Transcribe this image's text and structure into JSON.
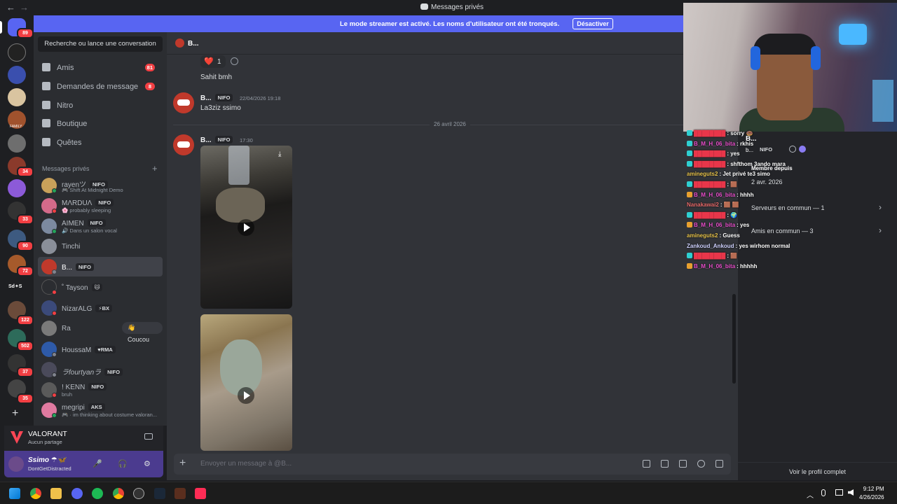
{
  "window": {
    "title": "Messages privés",
    "back": "←",
    "forward": "→"
  },
  "banner": {
    "text": "Le mode streamer est activé. Les noms d'utilisateur ont été tronqués.",
    "button": "Désactiver"
  },
  "rail": {
    "badges": [
      "89",
      "34",
      "33",
      "90",
      "72",
      "122",
      "502",
      "37",
      "35"
    ],
    "text_server": "Sd✦S",
    "family_label": "FAMILY",
    "add": "+"
  },
  "sidebar": {
    "search": "Recherche ou lance une conversation",
    "nav": [
      {
        "label": "Amis",
        "badge": "81"
      },
      {
        "label": "Demandes de message",
        "badge": "8"
      },
      {
        "label": "Nitro",
        "badge": ""
      },
      {
        "label": "Boutique",
        "badge": ""
      },
      {
        "label": "Quêtes",
        "badge": ""
      }
    ],
    "dm_header": "Messages privés",
    "dm_plus": "+",
    "dms": [
      {
        "name": "rayenツ",
        "tag": "NIFO",
        "sub": "🎮 Shift At Midnight Demo"
      },
      {
        "name": "MΛRDUΛ",
        "tag": "NIFO",
        "sub": "🌸 probably sleeping"
      },
      {
        "name": "AIMEN",
        "tag": "NIFO",
        "sub": "🔊 Dans un salon vocal"
      },
      {
        "name": "Tinchi",
        "tag": "",
        "sub": ""
      },
      {
        "name": "B...",
        "tag": "NIFO",
        "sub": ""
      },
      {
        "name": "˚ Tayson",
        "tag": "🐱",
        "sub": ""
      },
      {
        "name": "NizarALG",
        "tag": "⚡BX",
        "sub": ""
      },
      {
        "name": "Ra",
        "tag": "",
        "sub": "",
        "action": "👋 Coucou"
      },
      {
        "name": "HoussaM",
        "tag": "♥RMA",
        "sub": ""
      },
      {
        "name": "ラfourtyanラ",
        "tag": "NIFO",
        "sub": ""
      },
      {
        "name": "! KENN",
        "tag": "NIFO",
        "sub": "bruh"
      },
      {
        "name": "megripi",
        "tag": "AKS",
        "sub": "🎮 · im thinking about costume valoran..."
      }
    ]
  },
  "voice": {
    "game": "VALORANT",
    "status": "Aucun partage"
  },
  "user": {
    "name": "Ssimo ☂🦋",
    "status": "DontGetDistracted",
    "mic": "🎤",
    "headset": "🎧",
    "settings": "⚙"
  },
  "chat": {
    "header_name": "B...",
    "reaction": {
      "emoji": "❤️",
      "count": "1"
    },
    "messages": [
      {
        "text": "Sahit bmh"
      },
      {
        "author": "B...",
        "tag": "NIFO",
        "time": "22/04/2026 19:18",
        "text": "La3ziz ssimo"
      },
      {
        "author": "B...",
        "tag": "NIFO",
        "time": "17:30"
      }
    ],
    "divider": "26 avril 2026",
    "composer_plus": "+",
    "composer_placeholder": "Envoyer un message à @B...",
    "download": "⤓"
  },
  "profile": {
    "name": "B...",
    "sub": "b...",
    "tag": "NIFO",
    "member_label": "Membre depuis",
    "member_date": "2 avr. 2026",
    "rows": [
      {
        "label": "Serveurs en commun — 1",
        "chevron": "›"
      },
      {
        "label": "Amis en commun — 3",
        "chevron": "›"
      }
    ],
    "full": "Voir le profil complet"
  },
  "stream_chat": [
    {
      "user": "████████",
      "msg": ": sorry 🍩",
      "color": "#e8364a",
      "badge": "#2ecfd1"
    },
    {
      "user": "B_M_H_06_bita",
      "msg": ": rkhis",
      "color": "#e84ecb",
      "badge": "#2ecfd1"
    },
    {
      "user": "████████",
      "msg": ": yes",
      "color": "#e8364a",
      "badge": "#2ecfd1"
    },
    {
      "user": "████████",
      "msg": ": shfthom 3ando mara",
      "color": "#e8364a",
      "badge": "#2ecfd1"
    },
    {
      "user": "amineguts2",
      "msg": ": Jet privé te3 simo",
      "color": "#e6c24a",
      "badge": ""
    },
    {
      "user": "████████",
      "msg": ": 🟫",
      "color": "#e8364a",
      "badge": "#2ecfd1"
    },
    {
      "user": "B_M_H_06_bita",
      "msg": ": hhhh",
      "color": "#e84ecb",
      "badge": "#e8a02e"
    },
    {
      "user": "Nanakawai2",
      "msg": ": 🟫 🟫",
      "color": "#e86a6a",
      "badge": ""
    },
    {
      "user": "████████",
      "msg": ": 🌍",
      "color": "#e8364a",
      "badge": "#2ecfd1"
    },
    {
      "user": "B_M_H_06_bita",
      "msg": ": yes",
      "color": "#e84ecb",
      "badge": "#e8a02e"
    },
    {
      "user": "amineguts2",
      "msg": ": Guess",
      "color": "#e6c24a",
      "badge": ""
    },
    {
      "user": "Zankoud_Ankoud",
      "msg": ": yes wirhom normal",
      "color": "#cfd2ff",
      "badge": ""
    },
    {
      "user": "████████",
      "msg": ": 🟫",
      "color": "#e8364a",
      "badge": "#2ecfd1"
    },
    {
      "user": "B_M_H_06_bita",
      "msg": ": hhhhh",
      "color": "#e84ecb",
      "badge": "#e8a02e"
    }
  ],
  "taskbar": {
    "time": "9:12 PM",
    "date": "4/26/2026",
    "overflow": "︿"
  },
  "colors": {
    "accent": "#5865f2",
    "badge": "#f23f43",
    "online": "#23a55a",
    "idle": "#f0b232",
    "dnd": "#f23f43",
    "offline": "#80848e"
  }
}
